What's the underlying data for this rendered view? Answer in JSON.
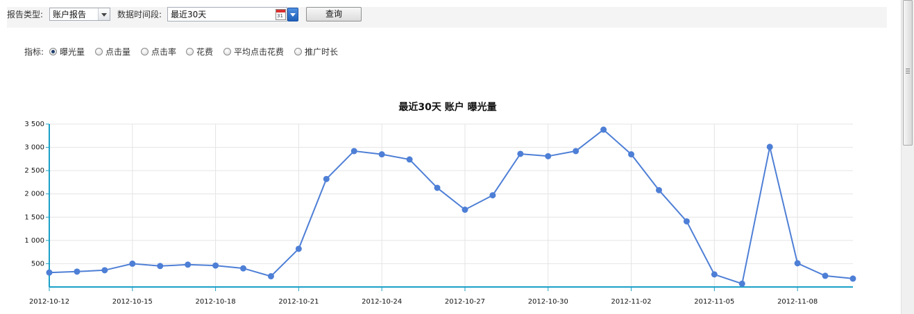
{
  "toolbar": {
    "report_type_label": "报告类型:",
    "report_type_value": "账户报告",
    "period_label": "数据时间段:",
    "period_value": "最近30天",
    "calendar_number": "31",
    "query_button": "查询"
  },
  "metrics": {
    "label": "指标:",
    "options": [
      {
        "label": "曝光量",
        "checked": true
      },
      {
        "label": "点击量",
        "checked": false
      },
      {
        "label": "点击率",
        "checked": false
      },
      {
        "label": "花费",
        "checked": false
      },
      {
        "label": "平均点击花费",
        "checked": false
      },
      {
        "label": "推广时长",
        "checked": false
      }
    ]
  },
  "colors": {
    "line": "#4e7fd6",
    "axis": "#1aa0c8",
    "grid": "#e4e4e4"
  },
  "chart_data": {
    "type": "line",
    "title": "最近30天 账户  曝光量",
    "xlabel": "",
    "ylabel": "",
    "ylim": [
      0,
      3500
    ],
    "grid": true,
    "y_ticks": [
      500,
      1000,
      1500,
      2000,
      2500,
      3000,
      3500
    ],
    "y_tick_labels": [
      "500",
      "1 000",
      "1 500",
      "2 000",
      "2 500",
      "3 000",
      "3 500"
    ],
    "x_tick_labels": [
      "2012-10-12",
      "2012-10-15",
      "2012-10-18",
      "2012-10-21",
      "2012-10-24",
      "2012-10-27",
      "2012-10-30",
      "2012-11-02",
      "2012-11-05",
      "2012-11-08"
    ],
    "x": [
      "2012-10-12",
      "2012-10-13",
      "2012-10-14",
      "2012-10-15",
      "2012-10-16",
      "2012-10-17",
      "2012-10-18",
      "2012-10-19",
      "2012-10-20",
      "2012-10-21",
      "2012-10-22",
      "2012-10-23",
      "2012-10-24",
      "2012-10-25",
      "2012-10-26",
      "2012-10-27",
      "2012-10-28",
      "2012-10-29",
      "2012-10-30",
      "2012-10-31",
      "2012-11-01",
      "2012-11-02",
      "2012-11-03",
      "2012-11-04",
      "2012-11-05",
      "2012-11-06",
      "2012-11-07",
      "2012-11-08",
      "2012-11-09",
      "2012-11-10"
    ],
    "series": [
      {
        "values": [
          310,
          330,
          360,
          500,
          450,
          480,
          460,
          400,
          230,
          820,
          2320,
          2920,
          2850,
          2740,
          2130,
          1660,
          1970,
          2860,
          2810,
          2920,
          3380,
          2850,
          2080,
          1410,
          270,
          70,
          3010,
          510,
          240,
          180
        ]
      }
    ]
  }
}
